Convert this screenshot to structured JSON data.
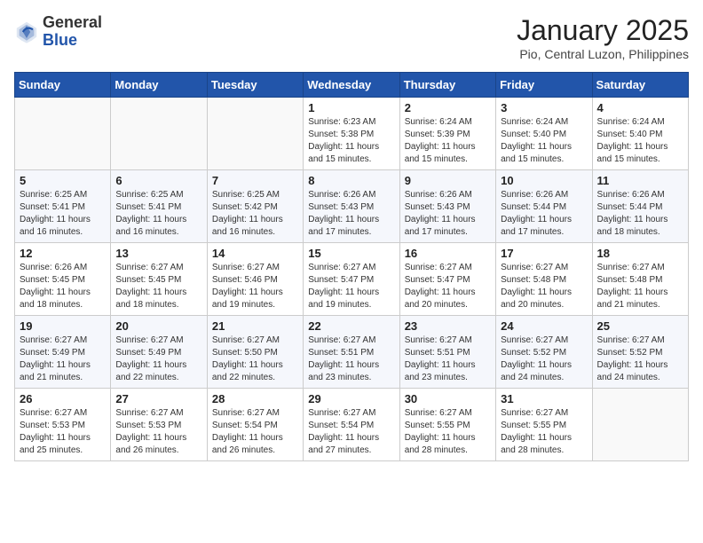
{
  "header": {
    "logo_general": "General",
    "logo_blue": "Blue",
    "month_title": "January 2025",
    "location": "Pio, Central Luzon, Philippines"
  },
  "calendar": {
    "days_of_week": [
      "Sunday",
      "Monday",
      "Tuesday",
      "Wednesday",
      "Thursday",
      "Friday",
      "Saturday"
    ],
    "weeks": [
      [
        {
          "day": "",
          "info": ""
        },
        {
          "day": "",
          "info": ""
        },
        {
          "day": "",
          "info": ""
        },
        {
          "day": "1",
          "info": "Sunrise: 6:23 AM\nSunset: 5:38 PM\nDaylight: 11 hours\nand 15 minutes."
        },
        {
          "day": "2",
          "info": "Sunrise: 6:24 AM\nSunset: 5:39 PM\nDaylight: 11 hours\nand 15 minutes."
        },
        {
          "day": "3",
          "info": "Sunrise: 6:24 AM\nSunset: 5:40 PM\nDaylight: 11 hours\nand 15 minutes."
        },
        {
          "day": "4",
          "info": "Sunrise: 6:24 AM\nSunset: 5:40 PM\nDaylight: 11 hours\nand 15 minutes."
        }
      ],
      [
        {
          "day": "5",
          "info": "Sunrise: 6:25 AM\nSunset: 5:41 PM\nDaylight: 11 hours\nand 16 minutes."
        },
        {
          "day": "6",
          "info": "Sunrise: 6:25 AM\nSunset: 5:41 PM\nDaylight: 11 hours\nand 16 minutes."
        },
        {
          "day": "7",
          "info": "Sunrise: 6:25 AM\nSunset: 5:42 PM\nDaylight: 11 hours\nand 16 minutes."
        },
        {
          "day": "8",
          "info": "Sunrise: 6:26 AM\nSunset: 5:43 PM\nDaylight: 11 hours\nand 17 minutes."
        },
        {
          "day": "9",
          "info": "Sunrise: 6:26 AM\nSunset: 5:43 PM\nDaylight: 11 hours\nand 17 minutes."
        },
        {
          "day": "10",
          "info": "Sunrise: 6:26 AM\nSunset: 5:44 PM\nDaylight: 11 hours\nand 17 minutes."
        },
        {
          "day": "11",
          "info": "Sunrise: 6:26 AM\nSunset: 5:44 PM\nDaylight: 11 hours\nand 18 minutes."
        }
      ],
      [
        {
          "day": "12",
          "info": "Sunrise: 6:26 AM\nSunset: 5:45 PM\nDaylight: 11 hours\nand 18 minutes."
        },
        {
          "day": "13",
          "info": "Sunrise: 6:27 AM\nSunset: 5:45 PM\nDaylight: 11 hours\nand 18 minutes."
        },
        {
          "day": "14",
          "info": "Sunrise: 6:27 AM\nSunset: 5:46 PM\nDaylight: 11 hours\nand 19 minutes."
        },
        {
          "day": "15",
          "info": "Sunrise: 6:27 AM\nSunset: 5:47 PM\nDaylight: 11 hours\nand 19 minutes."
        },
        {
          "day": "16",
          "info": "Sunrise: 6:27 AM\nSunset: 5:47 PM\nDaylight: 11 hours\nand 20 minutes."
        },
        {
          "day": "17",
          "info": "Sunrise: 6:27 AM\nSunset: 5:48 PM\nDaylight: 11 hours\nand 20 minutes."
        },
        {
          "day": "18",
          "info": "Sunrise: 6:27 AM\nSunset: 5:48 PM\nDaylight: 11 hours\nand 21 minutes."
        }
      ],
      [
        {
          "day": "19",
          "info": "Sunrise: 6:27 AM\nSunset: 5:49 PM\nDaylight: 11 hours\nand 21 minutes."
        },
        {
          "day": "20",
          "info": "Sunrise: 6:27 AM\nSunset: 5:49 PM\nDaylight: 11 hours\nand 22 minutes."
        },
        {
          "day": "21",
          "info": "Sunrise: 6:27 AM\nSunset: 5:50 PM\nDaylight: 11 hours\nand 22 minutes."
        },
        {
          "day": "22",
          "info": "Sunrise: 6:27 AM\nSunset: 5:51 PM\nDaylight: 11 hours\nand 23 minutes."
        },
        {
          "day": "23",
          "info": "Sunrise: 6:27 AM\nSunset: 5:51 PM\nDaylight: 11 hours\nand 23 minutes."
        },
        {
          "day": "24",
          "info": "Sunrise: 6:27 AM\nSunset: 5:52 PM\nDaylight: 11 hours\nand 24 minutes."
        },
        {
          "day": "25",
          "info": "Sunrise: 6:27 AM\nSunset: 5:52 PM\nDaylight: 11 hours\nand 24 minutes."
        }
      ],
      [
        {
          "day": "26",
          "info": "Sunrise: 6:27 AM\nSunset: 5:53 PM\nDaylight: 11 hours\nand 25 minutes."
        },
        {
          "day": "27",
          "info": "Sunrise: 6:27 AM\nSunset: 5:53 PM\nDaylight: 11 hours\nand 26 minutes."
        },
        {
          "day": "28",
          "info": "Sunrise: 6:27 AM\nSunset: 5:54 PM\nDaylight: 11 hours\nand 26 minutes."
        },
        {
          "day": "29",
          "info": "Sunrise: 6:27 AM\nSunset: 5:54 PM\nDaylight: 11 hours\nand 27 minutes."
        },
        {
          "day": "30",
          "info": "Sunrise: 6:27 AM\nSunset: 5:55 PM\nDaylight: 11 hours\nand 28 minutes."
        },
        {
          "day": "31",
          "info": "Sunrise: 6:27 AM\nSunset: 5:55 PM\nDaylight: 11 hours\nand 28 minutes."
        },
        {
          "day": "",
          "info": ""
        }
      ]
    ]
  }
}
